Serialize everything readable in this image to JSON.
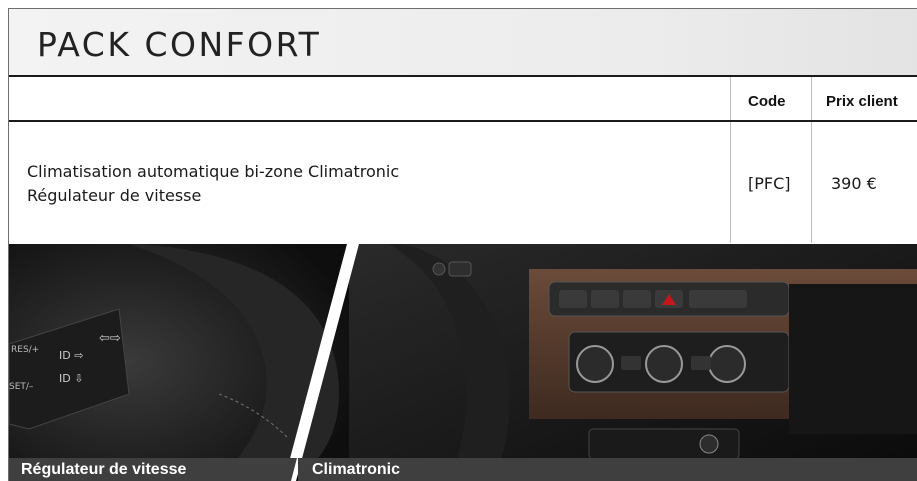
{
  "title": "PACK CONFORT",
  "table": {
    "headers": {
      "code": "Code",
      "price": "Prix client"
    },
    "row": {
      "items": [
        "Climatisation automatique bi-zone Climatronic",
        "Régulateur de vitesse"
      ],
      "code": "[PFC]",
      "price": "390 €"
    }
  },
  "captions": {
    "left": "Régulateur de vitesse",
    "right": "Climatronic"
  },
  "colors": {
    "accent_red": "#c4171c",
    "dark": "#1a1a1a",
    "wood": "#5a3a2a"
  }
}
